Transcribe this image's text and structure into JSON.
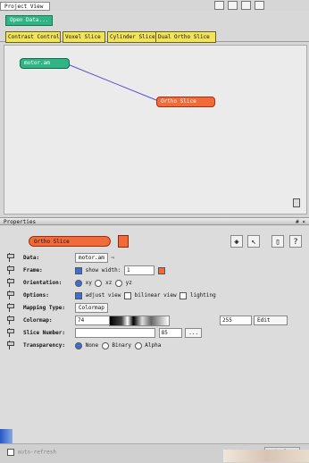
{
  "project_view": {
    "title": "Project View",
    "open_data_label": "Open Data...",
    "buttons": [
      "Contrast Control",
      "Voxel Slice",
      "Cylinder Slice",
      "Dual Ortho Slice"
    ],
    "nodes": {
      "data": "motor.am",
      "ortho": "Ortho Slice"
    }
  },
  "properties": {
    "title": "Properties",
    "close": "# ×",
    "module_name": "Ortho Slice",
    "rows": {
      "data": {
        "label": "Data:",
        "value": "motor.am"
      },
      "frame": {
        "label": "Frame:",
        "show": "show",
        "width_label": "width:",
        "width_value": "1"
      },
      "orientation": {
        "label": "Orientation:",
        "options": [
          "xy",
          "xz",
          "yz"
        ]
      },
      "options": {
        "label": "Options:",
        "items": [
          "adjust view",
          "bilinear view",
          "lighting"
        ]
      },
      "mapping": {
        "label": "Mapping Type:",
        "value": "Colormap"
      },
      "colormap": {
        "label": "Colormap:",
        "min": "74",
        "max": "255",
        "edit": "Edit"
      },
      "slice": {
        "label": "Slice Number:",
        "value": "85",
        "more": "..."
      },
      "transparency": {
        "label": "Transparency:",
        "options": [
          "None",
          "Binary",
          "Alpha"
        ]
      }
    },
    "footer": {
      "auto_refresh": "auto-refresh",
      "apply": "Apply"
    }
  },
  "colors": {
    "green": "#2fb486",
    "orange": "#f06a3a",
    "yellow": "#f2e45a"
  },
  "icons": [
    "help-icon",
    "frame-icon",
    "cursor-icon",
    "cube-icon",
    "trash-icon"
  ]
}
